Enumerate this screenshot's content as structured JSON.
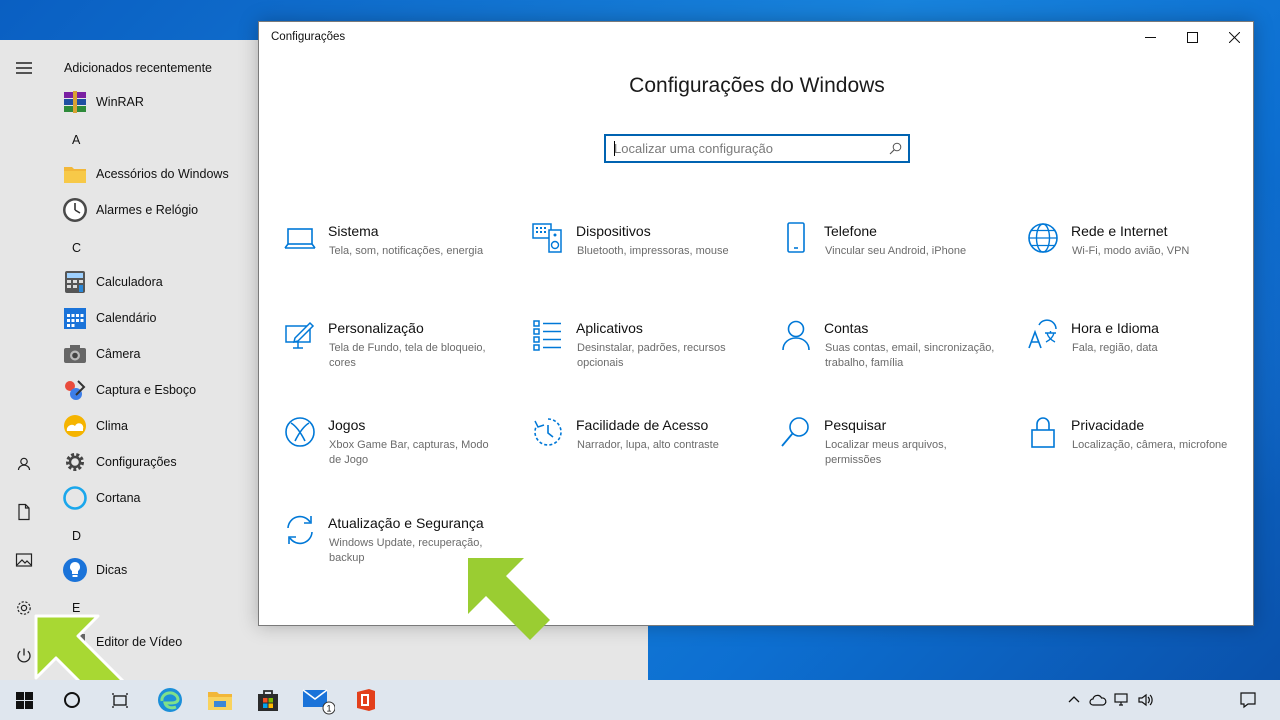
{
  "start_menu": {
    "section_header": "Adicionados recentemente",
    "letters": [
      "A",
      "C",
      "D",
      "E"
    ],
    "apps": [
      {
        "label": "WinRAR",
        "icon": "winrar-icon"
      },
      {
        "label": "Acessórios do Windows",
        "icon": "folder-icon"
      },
      {
        "label": "Alarmes e Relógio",
        "icon": "clock-icon"
      },
      {
        "label": "Calculadora",
        "icon": "calculator-icon"
      },
      {
        "label": "Calendário",
        "icon": "calendar-icon"
      },
      {
        "label": "Câmera",
        "icon": "camera-icon"
      },
      {
        "label": "Captura e Esboço",
        "icon": "snip-icon"
      },
      {
        "label": "Clima",
        "icon": "weather-icon"
      },
      {
        "label": "Configurações",
        "icon": "gear-icon"
      },
      {
        "label": "Cortana",
        "icon": "cortana-icon"
      },
      {
        "label": "Dicas",
        "icon": "tips-icon"
      },
      {
        "label": "Editor de Vídeo",
        "icon": "video-editor-icon"
      }
    ],
    "rail": [
      "hamburger-icon",
      "user-icon",
      "documents-icon",
      "pictures-icon",
      "settings-icon",
      "power-icon"
    ]
  },
  "window": {
    "title": "Configurações",
    "heading": "Configurações do Windows",
    "search_placeholder": "Localizar uma configuração",
    "categories": [
      {
        "name": "Sistema",
        "desc": "Tela, som, notificações, energia",
        "icon": "laptop-icon"
      },
      {
        "name": "Dispositivos",
        "desc": "Bluetooth, impressoras, mouse",
        "icon": "devices-icon"
      },
      {
        "name": "Telefone",
        "desc": "Vincular seu Android, iPhone",
        "icon": "phone-icon"
      },
      {
        "name": "Rede e Internet",
        "desc": "Wi-Fi, modo avião, VPN",
        "icon": "globe-icon"
      },
      {
        "name": "Personalização",
        "desc": "Tela de Fundo, tela de bloqueio, cores",
        "icon": "personalization-icon"
      },
      {
        "name": "Aplicativos",
        "desc": "Desinstalar, padrões, recursos opcionais",
        "icon": "apps-list-icon"
      },
      {
        "name": "Contas",
        "desc": "Suas contas, email, sincronização, trabalho, família",
        "icon": "person-icon"
      },
      {
        "name": "Hora e Idioma",
        "desc": "Fala, região, data",
        "icon": "time-language-icon"
      },
      {
        "name": "Jogos",
        "desc": "Xbox Game Bar, capturas, Modo de Jogo",
        "icon": "xbox-icon"
      },
      {
        "name": "Facilidade de Acesso",
        "desc": "Narrador, lupa, alto contraste",
        "icon": "ease-of-access-icon"
      },
      {
        "name": "Pesquisar",
        "desc": "Localizar meus arquivos, permissões",
        "icon": "search-icon"
      },
      {
        "name": "Privacidade",
        "desc": "Localização, câmera, microfone",
        "icon": "lock-icon"
      },
      {
        "name": "Atualização e Segurança",
        "desc": "Windows Update, recuperação, backup",
        "icon": "update-icon"
      }
    ]
  },
  "taskbar": {
    "apps": [
      "windows-start-icon",
      "search-circle-icon",
      "task-view-icon",
      "edge-icon",
      "file-explorer-icon",
      "store-icon",
      "mail-icon",
      "office-icon"
    ],
    "mail_badge": "1"
  },
  "colors": {
    "accent": "#0063b1",
    "icon_blue": "#0078d7",
    "arrow_green": "#9acd32",
    "start_bg": "#e6e6e6",
    "taskbar_bg": "#dfe6ee"
  }
}
